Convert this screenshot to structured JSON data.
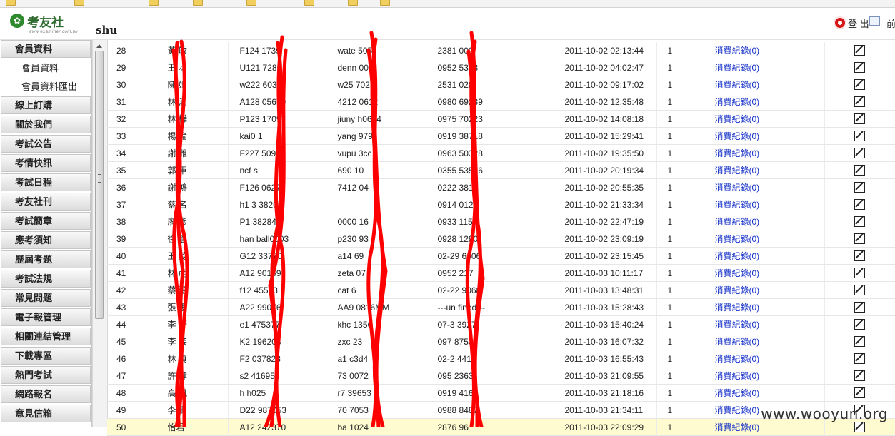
{
  "header": {
    "logo_text": "考友社",
    "logo_url": "www.examiner.com.tw",
    "user": "shu",
    "logout_label": "登 出",
    "front_label": "前"
  },
  "sidebar": {
    "items": [
      {
        "label": "會員資料",
        "type": "header"
      },
      {
        "label": "會員資料",
        "type": "sub"
      },
      {
        "label": "會員資料匯出",
        "type": "sub"
      },
      {
        "label": "線上訂購",
        "type": "header"
      },
      {
        "label": "關於我們",
        "type": "header"
      },
      {
        "label": "考試公告",
        "type": "header"
      },
      {
        "label": "考情快訊",
        "type": "header"
      },
      {
        "label": "考試日程",
        "type": "header"
      },
      {
        "label": "考友社刊",
        "type": "header"
      },
      {
        "label": "考試簡章",
        "type": "header"
      },
      {
        "label": "應考須知",
        "type": "header"
      },
      {
        "label": "歷屆考題",
        "type": "header"
      },
      {
        "label": "考試法規",
        "type": "header"
      },
      {
        "label": "常見問題",
        "type": "header"
      },
      {
        "label": "電子報管理",
        "type": "header"
      },
      {
        "label": "相關連結管理",
        "type": "header"
      },
      {
        "label": "下載專區",
        "type": "header"
      },
      {
        "label": "熱門考試",
        "type": "header"
      },
      {
        "label": "網路報名",
        "type": "header"
      },
      {
        "label": "意見信箱",
        "type": "header"
      }
    ]
  },
  "table": {
    "highlight_row": 22,
    "rows": [
      {
        "no": "28",
        "name": "黃 敏",
        "id": "F124 1739",
        "account": "wate 505",
        "phone": "2381 000",
        "time": "2011-10-02 02:13:44",
        "count": "1",
        "link": "消費紀錄(0)"
      },
      {
        "no": "29",
        "name": "王 丞",
        "id": "U121 7285",
        "account": "denn 00",
        "phone": "0952 5363",
        "time": "2011-10-02 04:02:47",
        "count": "1",
        "link": "消費紀錄(0)"
      },
      {
        "no": "30",
        "name": "陳 姐",
        "id": "w222 6036",
        "account": "w25 7028",
        "phone": "2531 028",
        "time": "2011-10-02 09:17:02",
        "count": "1",
        "link": "消費紀錄(0)"
      },
      {
        "no": "31",
        "name": "林 涵",
        "id": "A128 05670",
        "account": "4212 0612",
        "phone": "0980 69239",
        "time": "2011-10-02 12:35:48",
        "count": "1",
        "link": "消費紀錄(0)"
      },
      {
        "no": "32",
        "name": "林 樺",
        "id": "P123 17097",
        "account": "jiuny h0624",
        "phone": "0975 70223",
        "time": "2011-10-02 14:08:18",
        "count": "1",
        "link": "消費紀錄(0)"
      },
      {
        "no": "33",
        "name": "楊 倫",
        "id": "kai0 1",
        "account": "yang 979",
        "phone": "0919 38718",
        "time": "2011-10-02 15:29:41",
        "count": "1",
        "link": "消費紀錄(0)"
      },
      {
        "no": "34",
        "name": "謝 雅",
        "id": "F227 50918",
        "account": "vupu 3cc",
        "phone": "0963 50328",
        "time": "2011-10-02 19:35:50",
        "count": "1",
        "link": "消費紀錄(0)"
      },
      {
        "no": "35",
        "name": "郭 軍",
        "id": "ncf s",
        "account": "690 10",
        "phone": "0355 53596",
        "time": "2011-10-02 20:19:34",
        "count": "1",
        "link": "消費紀錄(0)"
      },
      {
        "no": "36",
        "name": "謝 鴻",
        "id": "F126 0627",
        "account": "7412 04",
        "phone": "0222 3812",
        "time": "2011-10-02 20:55:35",
        "count": "1",
        "link": "消費紀錄(0)"
      },
      {
        "no": "37",
        "name": "蔡 名",
        "id": "h1 3 3820",
        "account": "",
        "phone": "0914 012",
        "time": "2011-10-02 21:33:34",
        "count": "1",
        "link": "消費紀錄(0)"
      },
      {
        "no": "38",
        "name": "廖 彥",
        "id": "P1 38284",
        "account": "0000 16",
        "phone": "0933 1157",
        "time": "2011-10-02 22:47:19",
        "count": "1",
        "link": "消費紀錄(0)"
      },
      {
        "no": "39",
        "name": "徐 豎",
        "id": "han ball0003",
        "account": "p230 93",
        "phone": "0928 1290",
        "time": "2011-10-02 23:09:19",
        "count": "1",
        "link": "消費紀錄(0)"
      },
      {
        "no": "40",
        "name": "王 嫈",
        "id": "G12 33770",
        "account": "a14 69",
        "phone": "02-29 6606",
        "time": "2011-10-02 23:15:45",
        "count": "1",
        "link": "消費紀錄(0)"
      },
      {
        "no": "41",
        "name": "林 萌",
        "id": "A12 90159",
        "account": "zeta 07",
        "phone": "0952 217",
        "time": "2011-10-03 10:11:17",
        "count": "1",
        "link": "消費紀錄(0)"
      },
      {
        "no": "42",
        "name": "蔡 涵",
        "id": "f12 45533",
        "account": "cat 6",
        "phone": "02-22 9068",
        "time": "2011-10-03 13:48:31",
        "count": "1",
        "link": "消費紀錄(0)"
      },
      {
        "no": "43",
        "name": "張 惠",
        "id": "A22 99076",
        "account": "AA9 0816MM",
        "phone": "---un fined---",
        "time": "2011-10-03 15:28:43",
        "count": "1",
        "link": "消費紀錄(0)"
      },
      {
        "no": "44",
        "name": "李 軒",
        "id": "e1 475377",
        "account": "khc 1356",
        "phone": "07-3 3927",
        "time": "2011-10-03 15:40:24",
        "count": "1",
        "link": "消費紀錄(0)"
      },
      {
        "no": "45",
        "name": "李 芸",
        "id": "K2 196203",
        "account": "zxc 23",
        "phone": "097 8753",
        "time": "2011-10-03 16:07:32",
        "count": "1",
        "link": "消費紀錄(0)"
      },
      {
        "no": "46",
        "name": "林 貞",
        "id": "F2 037823",
        "account": "a1 c3d4",
        "phone": "02-2 4413",
        "time": "2011-10-03 16:55:43",
        "count": "1",
        "link": "消費紀錄(0)"
      },
      {
        "no": "47",
        "name": "許 肆",
        "id": "s2 416959",
        "account": "73 0072",
        "phone": "095 2363",
        "time": "2011-10-03 21:09:55",
        "count": "1",
        "link": "消費紀錄(0)"
      },
      {
        "no": "48",
        "name": "高 凱",
        "id": "h h025",
        "account": "r7 39653",
        "phone": "0919 4167",
        "time": "2011-10-03 21:18:16",
        "count": "1",
        "link": "消費紀錄(0)"
      },
      {
        "no": "49",
        "name": "李 鸞",
        "id": "D22 987053",
        "account": "70 7053",
        "phone": "0988 8487",
        "time": "2011-10-03 21:34:11",
        "count": "1",
        "link": "消費紀錄(0)"
      },
      {
        "no": "50",
        "name": "怡君",
        "id": "A12 242370",
        "account": "ba 1024",
        "phone": "2876 96",
        "time": "2011-10-03 22:09:29",
        "count": "1",
        "link": "消費紀錄(0)"
      }
    ]
  },
  "watermark": "www.wooyun.org",
  "colors": {
    "link": "#1530c8",
    "highlight": "#fffbd1",
    "redaction": "#ff0000"
  }
}
